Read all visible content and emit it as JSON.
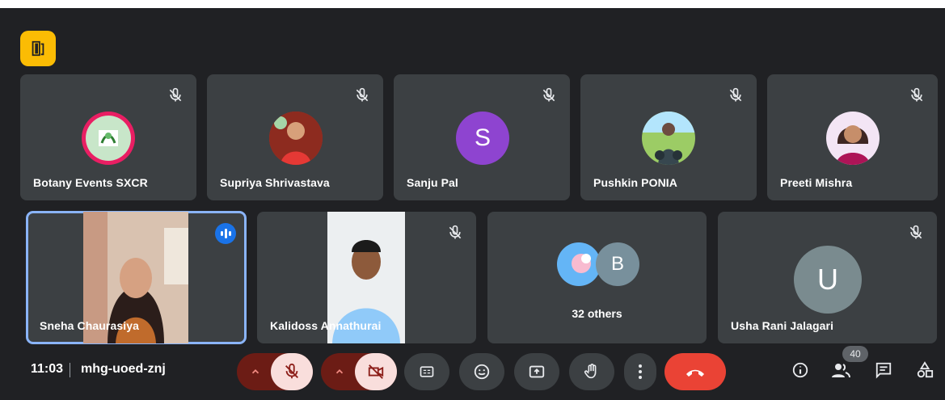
{
  "meeting": {
    "time": "11:03",
    "code": "mhg-uoed-znj",
    "participant_count": "40"
  },
  "tiles_row1": [
    {
      "name": "Botany Events SXCR",
      "avatar": "image",
      "avatar_color": "#c8e6c9"
    },
    {
      "name": "Supriya Shrivastava",
      "avatar": "image",
      "avatar_color": "#b71c1c"
    },
    {
      "name": "Sanju Pal",
      "avatar": "letter",
      "letter": "S",
      "avatar_color": "#8e44d0"
    },
    {
      "name": "Pushkin PONIA",
      "avatar": "image",
      "avatar_color": "#7cb342"
    },
    {
      "name": "Preeti Mishra",
      "avatar": "image",
      "avatar_color": "#e1bee7"
    }
  ],
  "tiles_row2": [
    {
      "name": "Sneha Chaurasiya",
      "video": true,
      "speaking": true
    },
    {
      "name": "Kalidoss Annathurai",
      "video": true
    },
    {
      "name": "32 others",
      "group": true,
      "letter": "B"
    },
    {
      "name": "Usha Rani Jalagari",
      "avatar": "letter",
      "letter": "U",
      "avatar_color": "#7a8b8f"
    }
  ],
  "icons": {
    "mic": "mic-off-icon",
    "camera": "camera-off-icon",
    "captions": "captions-icon",
    "emoji": "emoji-icon",
    "present": "present-icon",
    "hand": "raise-hand-icon",
    "more": "more-vert-icon",
    "end": "end-call-icon",
    "info": "info-icon",
    "people": "people-icon",
    "chat": "chat-icon",
    "activities": "activities-icon"
  },
  "colors": {
    "background": "#202124",
    "tile": "#3c4043",
    "end_call": "#ea4335",
    "off_button": "#f9dedc",
    "active_outline": "#8ab4f8",
    "badge": "#fbbc04"
  }
}
